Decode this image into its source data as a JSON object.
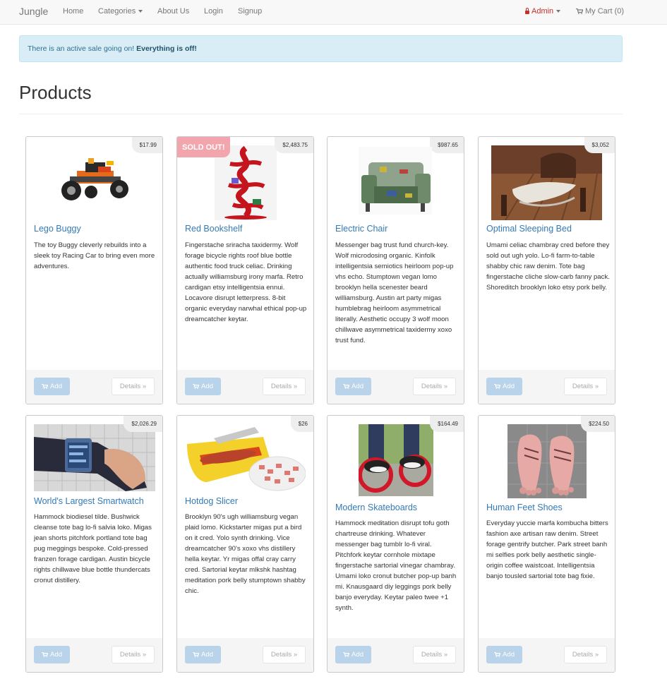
{
  "nav": {
    "brand": "Jungle",
    "home": "Home",
    "categories": "Categories",
    "about": "About Us",
    "login": "Login",
    "signup": "Signup",
    "admin": "Admin",
    "cart": "My Cart (0)"
  },
  "alert": {
    "text": "There is an active sale going on!",
    "bold": "Everything is off!"
  },
  "page": {
    "title": "Products"
  },
  "buttons": {
    "add": "Add",
    "details": "Details »"
  },
  "badges": {
    "sold_out": "SOLD OUT!"
  },
  "products": [
    {
      "name": "Lego Buggy",
      "price": "$17.99",
      "description": "The toy Buggy cleverly rebuilds into a sleek toy Racing Car to bring even more adventures."
    },
    {
      "name": "Red Bookshelf",
      "price": "$2,483.75",
      "description": "Fingerstache sriracha taxidermy. Wolf forage bicycle rights roof blue bottle authentic food truck celiac. Drinking actually williamsburg irony marfa. Retro cardigan etsy intelligentsia ennui. Locavore disrupt letterpress. 8-bit organic everyday narwhal ethical pop-up dreamcatcher keytar."
    },
    {
      "name": "Electric Chair",
      "price": "$987.65",
      "description": "Messenger bag trust fund church-key. Wolf microdosing organic. Kinfolk intelligentsia semiotics heirloom pop-up vhs echo. Stumptown vegan lomo brooklyn hella scenester beard williamsburg. Austin art party migas humblebrag heirloom asymmetrical literally. Aesthetic occupy 3 wolf moon chillwave asymmetrical taxidermy xoxo trust fund."
    },
    {
      "name": "Optimal Sleeping Bed",
      "price": "$3,052",
      "description": "Umami celiac chambray cred before they sold out ugh yolo. Lo-fi farm-to-table shabby chic raw denim. Tote bag fingerstache cliche slow-carb fanny pack. Shoreditch brooklyn loko etsy pork belly."
    },
    {
      "name": "World's Largest Smartwatch",
      "price": "$2,026.29",
      "description": "Hammock biodiesel tilde. Bushwick cleanse tote bag lo-fi salvia loko. Migas jean shorts pitchfork portland tote bag pug meggings bespoke. Cold-pressed franzen forage cardigan. Austin bicycle rights chillwave blue bottle thundercats cronut distillery."
    },
    {
      "name": "Hotdog Slicer",
      "price": "$26",
      "description": "Brooklyn 90's ugh williamsburg vegan plaid lomo. Kickstarter migas put a bird on it cred. Yolo synth drinking. Vice dreamcatcher 90's xoxo vhs distillery hella keytar. Yr migas offal cray carry cred. Sartorial keytar mlkshk hashtag meditation pork belly stumptown shabby chic."
    },
    {
      "name": "Modern Skateboards",
      "price": "$164.49",
      "description": "Hammock meditation disrupt tofu goth chartreuse drinking. Whatever messenger bag tumblr lo-fi viral. Pitchfork keytar cornhole mixtape fingerstache sartorial vinegar chambray. Umami loko cronut butcher pop-up banh mi. Knausgaard diy leggings pork belly banjo everyday. Keytar paleo twee +1 synth."
    },
    {
      "name": "Human Feet Shoes",
      "price": "$224.50",
      "description": "Everyday yuccie marfa kombucha bitters fashion axe artisan raw denim. Street forage gentrify butcher. Park street banh mi selfies pork belly aesthetic single-origin coffee waistcoat. Intelligentsia banjo tousled sartorial tote bag fixie."
    }
  ]
}
